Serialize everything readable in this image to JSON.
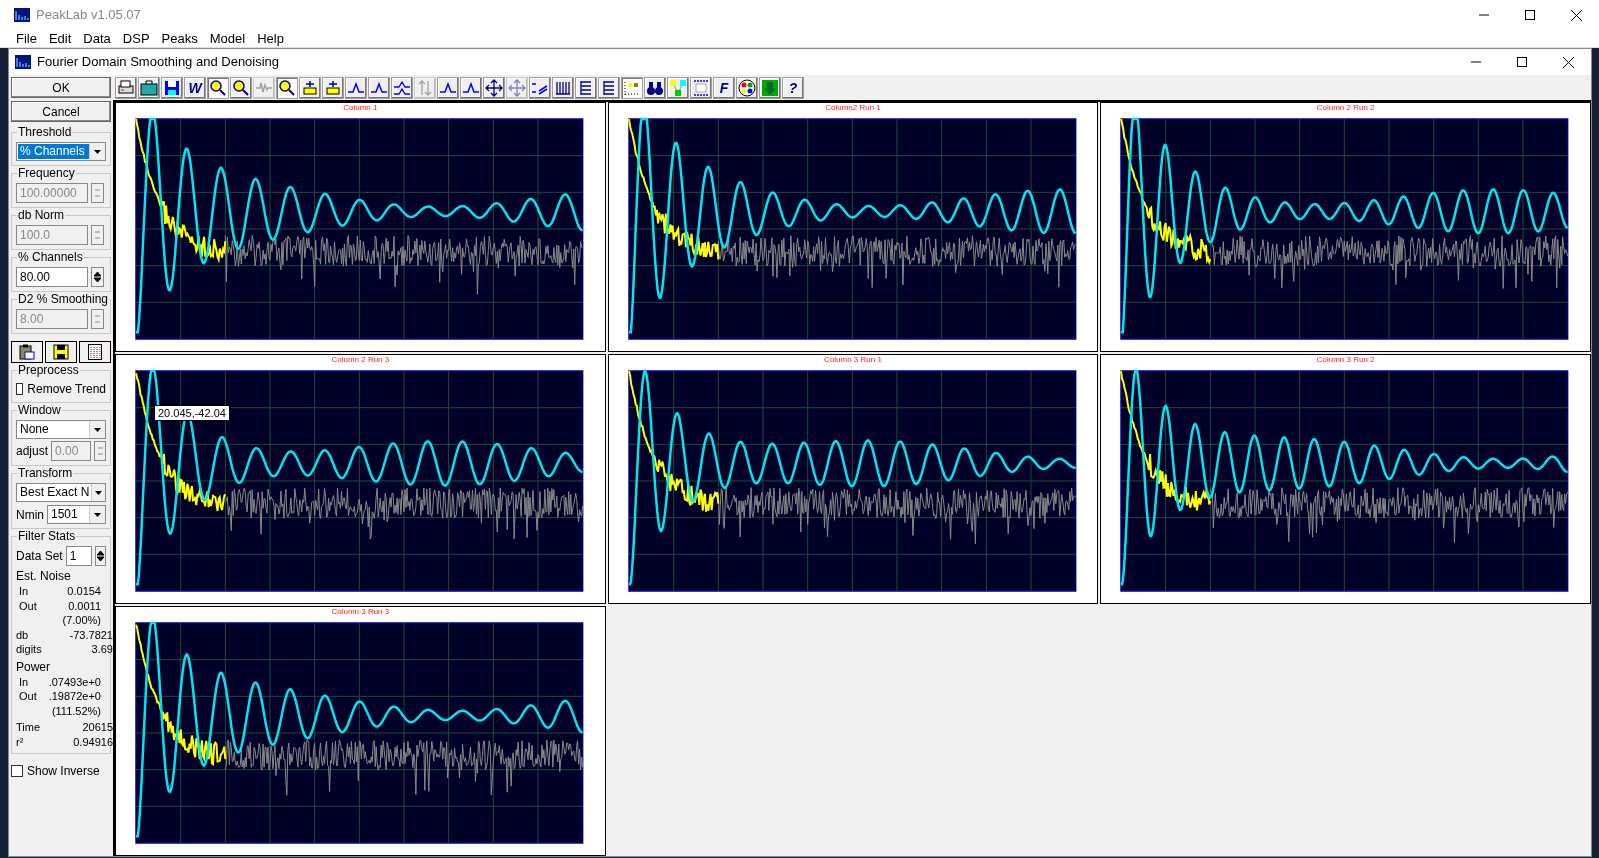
{
  "main_window": {
    "title": "PeakLab v1.05.07",
    "menu": [
      "File",
      "Edit",
      "Data",
      "DSP",
      "Peaks",
      "Model",
      "Help"
    ]
  },
  "dialog": {
    "title": "Fourier Domain Smoothing and Denoising"
  },
  "toolbar": [
    {
      "kind": "print",
      "disabled": false,
      "pressed": false
    },
    {
      "kind": "briefcase",
      "disabled": false,
      "pressed": false
    },
    {
      "kind": "save",
      "disabled": false,
      "pressed": false
    },
    {
      "kind": "letter",
      "label": "W",
      "disabled": false,
      "pressed": false
    },
    {
      "kind": "zoom",
      "disabled": false,
      "pressed": true
    },
    {
      "kind": "zoom",
      "disabled": false,
      "pressed": false
    },
    {
      "kind": "waveform",
      "disabled": true,
      "pressed": false
    },
    {
      "kind": "zoom",
      "disabled": false,
      "pressed": true
    },
    {
      "kind": "baseline",
      "disabled": false,
      "pressed": false
    },
    {
      "kind": "baseline",
      "disabled": false,
      "pressed": false
    },
    {
      "kind": "peak",
      "disabled": false,
      "pressed": false
    },
    {
      "kind": "peak",
      "disabled": false,
      "pressed": false
    },
    {
      "kind": "peaks",
      "disabled": false,
      "pressed": false
    },
    {
      "kind": "arrows",
      "disabled": true,
      "pressed": false
    },
    {
      "kind": "peak",
      "disabled": false,
      "pressed": false
    },
    {
      "kind": "peak",
      "disabled": false,
      "pressed": false
    },
    {
      "kind": "move",
      "disabled": false,
      "pressed": false
    },
    {
      "kind": "move",
      "disabled": true,
      "pressed": false
    },
    {
      "kind": "lines",
      "disabled": false,
      "pressed": false
    },
    {
      "kind": "bars",
      "disabled": false,
      "pressed": false
    },
    {
      "kind": "hlines",
      "disabled": false,
      "pressed": false
    },
    {
      "kind": "hlines",
      "disabled": false,
      "pressed": false
    },
    {
      "kind": "grid",
      "disabled": false,
      "pressed": true
    },
    {
      "kind": "binoculars",
      "disabled": false,
      "pressed": false
    },
    {
      "kind": "nodes",
      "disabled": false,
      "pressed": false
    },
    {
      "kind": "dots",
      "disabled": false,
      "pressed": false
    },
    {
      "kind": "letter",
      "label": "F",
      "disabled": false,
      "pressed": false
    },
    {
      "kind": "palette",
      "disabled": false,
      "pressed": false
    },
    {
      "kind": "download",
      "disabled": false,
      "pressed": false
    },
    {
      "kind": "letter",
      "label": "?",
      "disabled": false,
      "pressed": false
    }
  ],
  "buttons": [
    "OK",
    "Cancel"
  ],
  "threshold": {
    "legend": "Threshold",
    "value": "% Channels",
    "highlighted": true
  },
  "spin_fields": [
    {
      "legend": "Frequency",
      "value": "100.00000",
      "disabled": true
    },
    {
      "legend": "db Norm",
      "value": "100.0",
      "disabled": true
    },
    {
      "legend": "% Channels",
      "value": "80.00",
      "disabled": false
    },
    {
      "legend": "D2 % Smoothing",
      "value": "8.00",
      "disabled": true
    }
  ],
  "preprocess": {
    "legend": "Preprocess",
    "checkbox": {
      "label": "Remove Trend",
      "checked": false
    }
  },
  "window_group": {
    "legend": "Window",
    "value": "None",
    "adjust_label": "adjust",
    "adjust_value": "0.00",
    "adjust_disabled": true
  },
  "transform": {
    "legend": "Transform",
    "value": "Best Exact N",
    "nmin_label": "Nmin",
    "nmin_value": "1501"
  },
  "filter_stats": {
    "legend": "Filter Stats",
    "data_set_label": "Data Set",
    "data_set_value": "1",
    "rows": [
      {
        "kind": "heading",
        "text": "Est. Noise"
      },
      {
        "kind": "sub",
        "label": "In",
        "value": "0.0154"
      },
      {
        "kind": "sub",
        "label": "Out",
        "value": "0.0011"
      },
      {
        "kind": "sub",
        "value": "(7.00%)"
      },
      {
        "kind": "row",
        "label": "db",
        "value": "-73.7821"
      },
      {
        "kind": "row",
        "label": "digits",
        "value": "3.69"
      },
      {
        "kind": "heading",
        "text": "Power"
      },
      {
        "kind": "sub",
        "label": "In",
        "value": ".07493e+0"
      },
      {
        "kind": "sub",
        "label": "Out",
        "value": ".19872e+0"
      },
      {
        "kind": "sub",
        "value": "(111.52%)"
      },
      {
        "kind": "heading",
        "text": ""
      },
      {
        "kind": "row",
        "label": "Time",
        "value": "20615"
      },
      {
        "kind": "row",
        "label": "r²",
        "value": "0.94916"
      }
    ]
  },
  "show_inverse": {
    "label": "Show Inverse",
    "checked": false
  },
  "plots": [
    {
      "title": "Column 1"
    },
    {
      "title": "Column2 Run 1"
    },
    {
      "title": "Column 2 Run 2"
    },
    {
      "title": "Column 2 Run 3",
      "tooltip": "20.045,-42.04"
    },
    {
      "title": "Column 3 Run 1"
    },
    {
      "title": "Column 3 Run 2"
    },
    {
      "title": "Column 3 Run 3"
    }
  ]
}
